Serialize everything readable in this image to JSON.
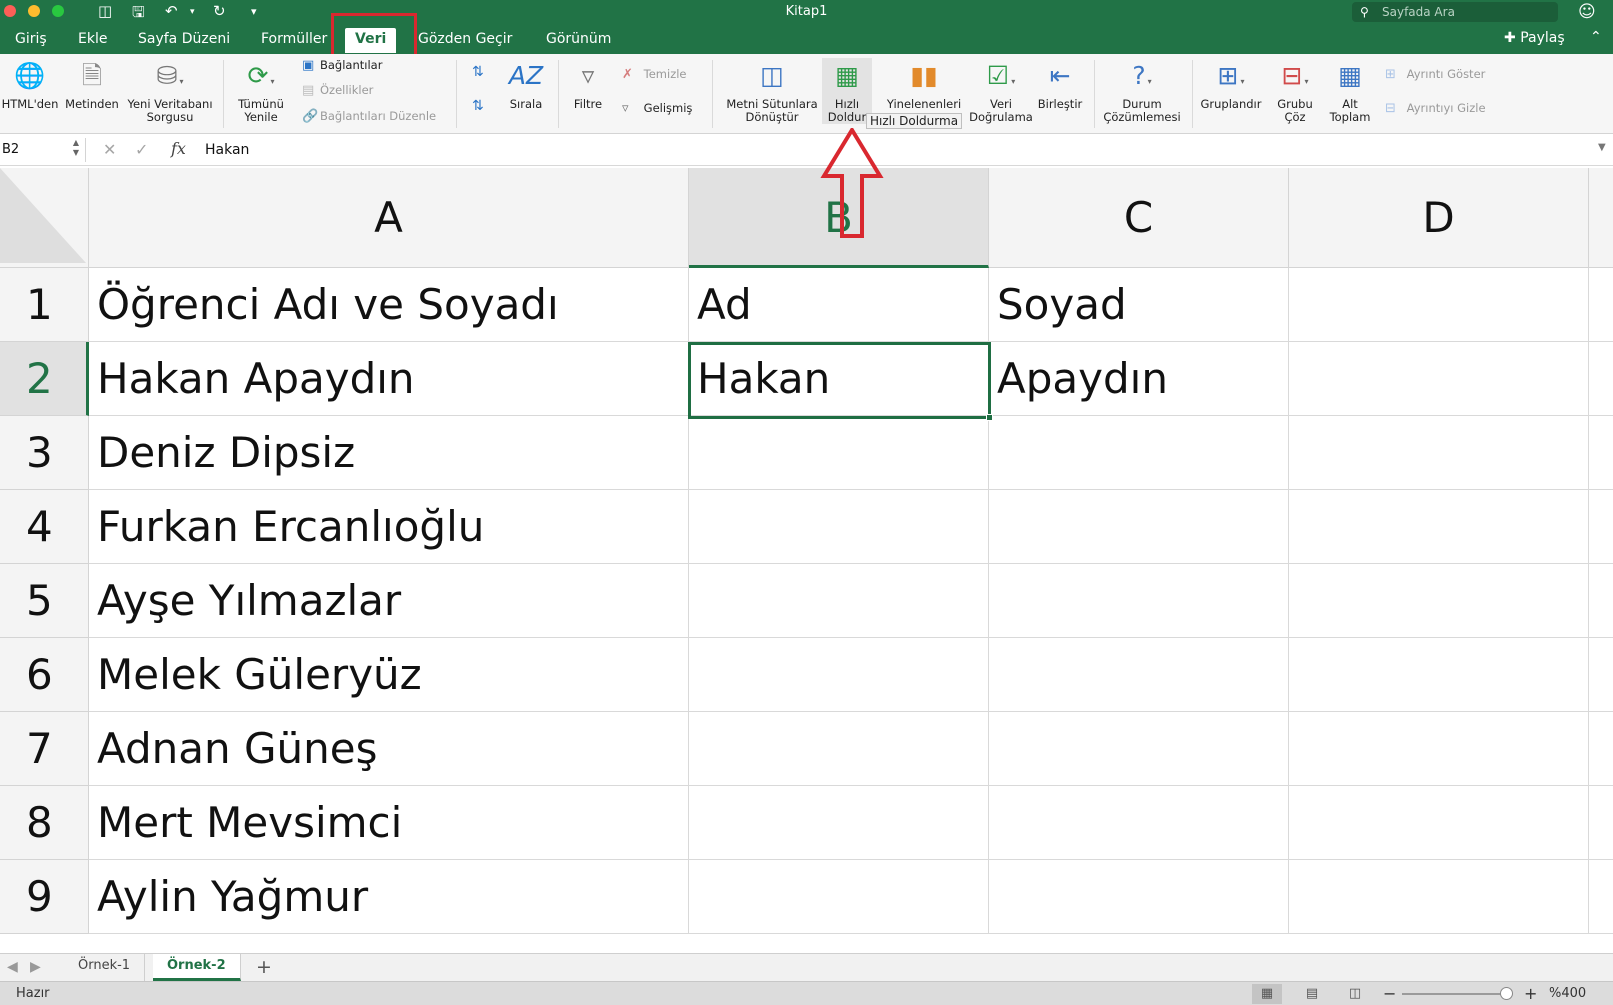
{
  "window": {
    "title": "Kitap1",
    "search_placeholder": "Sayfada Ara"
  },
  "tabs": [
    {
      "label": "Giriş"
    },
    {
      "label": "Ekle"
    },
    {
      "label": "Sayfa Düzeni"
    },
    {
      "label": "Formüller"
    },
    {
      "label": "Veri",
      "active": true
    },
    {
      "label": "Gözden Geçir"
    },
    {
      "label": "Görünüm"
    }
  ],
  "share_label": "Paylaş",
  "ribbon": {
    "html": "HTML'den",
    "text": "Metinden",
    "new_db_1": "Yeni Veritabanı",
    "new_db_2": "Sorgusu",
    "refresh_1": "Tümünü",
    "refresh_2": "Yenile",
    "connections": "Bağlantılar",
    "properties": "Özellikler",
    "edit_links": "Bağlantıları Düzenle",
    "sort": "Sırala",
    "filter": "Filtre",
    "clear": "Temizle",
    "advanced": "Gelişmiş",
    "text_to_cols_1": "Metni Sütunlara",
    "text_to_cols_2": "Dönüştür",
    "flash_fill_1": "Hızlı",
    "flash_fill_2": "Doldur",
    "remove_dup": "Yinelenenleri",
    "validation_1": "Veri",
    "validation_2": "Doğrulama",
    "consolidate": "Birleştir",
    "whatif_1": "Durum",
    "whatif_2": "Çözümlemesi",
    "group": "Gruplandır",
    "ungroup_1": "Grubu",
    "ungroup_2": "Çöz",
    "subtotal_1": "Alt",
    "subtotal_2": "Toplam",
    "show_detail": "Ayrıntı Göster",
    "hide_detail": "Ayrıntıyı Gizle",
    "tooltip": "Hızlı Doldurma"
  },
  "formula_bar": {
    "name_box": "B2",
    "value": "Hakan"
  },
  "columns": [
    "A",
    "B",
    "C",
    "D"
  ],
  "rows": [
    {
      "num": "1",
      "A": "Öğrenci Adı ve Soyadı",
      "B": "Ad",
      "C": "Soyad",
      "D": ""
    },
    {
      "num": "2",
      "A": "Hakan Apaydın",
      "B": "Hakan",
      "C": "Apaydın",
      "D": ""
    },
    {
      "num": "3",
      "A": "Deniz Dipsiz",
      "B": "",
      "C": "",
      "D": ""
    },
    {
      "num": "4",
      "A": "Furkan Ercanlıoğlu",
      "B": "",
      "C": "",
      "D": ""
    },
    {
      "num": "5",
      "A": "Ayşe Yılmazlar",
      "B": "",
      "C": "",
      "D": ""
    },
    {
      "num": "6",
      "A": "Melek Güleryüz",
      "B": "",
      "C": "",
      "D": ""
    },
    {
      "num": "7",
      "A": "Adnan Güneş",
      "B": "",
      "C": "",
      "D": ""
    },
    {
      "num": "8",
      "A": "Mert Mevsimci",
      "B": "",
      "C": "",
      "D": ""
    },
    {
      "num": "9",
      "A": "Aylin Yağmur",
      "B": "",
      "C": "",
      "D": ""
    }
  ],
  "sheets": [
    {
      "label": "Örnek-1"
    },
    {
      "label": "Örnek-2",
      "active": true
    }
  ],
  "status": {
    "ready": "Hazır",
    "zoom": "%400"
  },
  "colors": {
    "excel_green": "#217346",
    "highlight_red": "#d9282f"
  }
}
